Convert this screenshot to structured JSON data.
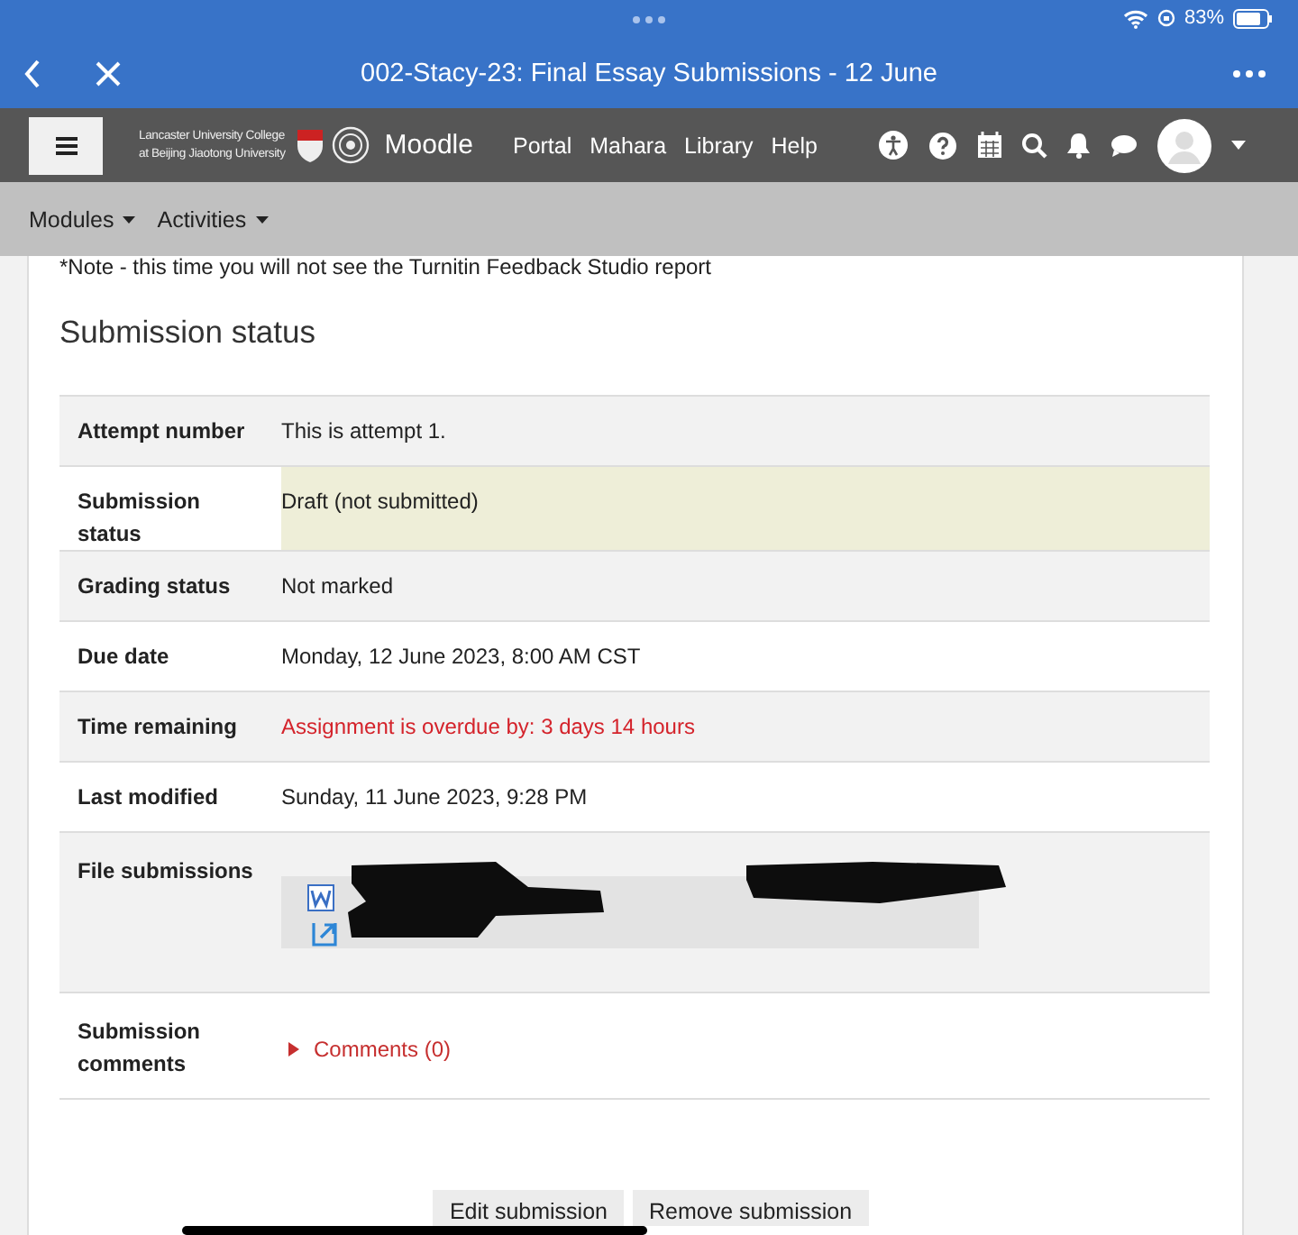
{
  "status_bar": {
    "battery": "83%"
  },
  "browser": {
    "title": "002-Stacy-23: Final Essay Submissions - 12 June"
  },
  "navbar": {
    "institution_lines": [
      "Lancaster University College",
      "at Beijing Jiaotong University"
    ],
    "site_name": "Moodle",
    "links": [
      "Portal",
      "Mahara",
      "Library",
      "Help"
    ]
  },
  "secondary_nav": [
    "Modules",
    "Activities"
  ],
  "note": "*Note - this time you will not see the Turnitin Feedback Studio report",
  "heading": "Submission status",
  "rows": [
    {
      "kind": "text",
      "label": "Attempt number",
      "value": "This is attempt 1.",
      "highlighted": false,
      "overdue": false
    },
    {
      "kind": "text",
      "label": "Submission status",
      "value": "Draft (not submitted)",
      "highlighted": true,
      "overdue": false
    },
    {
      "kind": "text",
      "label": "Grading status",
      "value": "Not marked",
      "highlighted": false,
      "overdue": false
    },
    {
      "kind": "text",
      "label": "Due date",
      "value": "Monday, 12 June 2023, 8:00 AM CST",
      "highlighted": false,
      "overdue": false
    },
    {
      "kind": "text",
      "label": "Time remaining",
      "value": "Assignment is overdue by: 3 days 14 hours",
      "highlighted": false,
      "overdue": true
    },
    {
      "kind": "text",
      "label": "Last modified",
      "value": "Sunday, 11 June 2023, 9:28 PM",
      "highlighted": false,
      "overdue": false
    },
    {
      "kind": "files",
      "label": "File submissions"
    },
    {
      "kind": "comments",
      "label": "Submission comments",
      "value": "Comments (0)",
      "expanded": false
    }
  ],
  "buttons": [
    "Edit submission",
    "Remove submission"
  ]
}
